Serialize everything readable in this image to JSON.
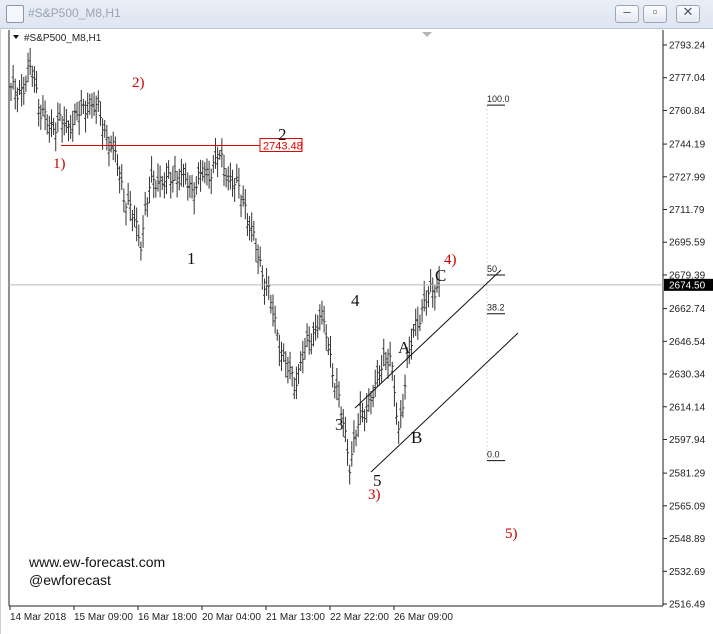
{
  "window": {
    "title": "#S&P500_M8,H1",
    "chart_label": "#S&P500_M8,H1",
    "buttons": [
      "minimize-icon",
      "maximize-icon",
      "close-icon"
    ]
  },
  "watermark": {
    "line1": "www.ew-forecast.com",
    "line2": "@ewforecast"
  },
  "chart_data": {
    "type": "bar",
    "subtype": "ohlc",
    "symbol": "#S&P500_M8",
    "timeframe": "H1",
    "y_ticks": [
      2793.24,
      2777.04,
      2760.84,
      2744.19,
      2727.99,
      2711.79,
      2695.59,
      2679.39,
      2662.74,
      2646.54,
      2630.34,
      2614.14,
      2597.94,
      2581.29,
      2565.09,
      2548.89,
      2532.69,
      2516.49
    ],
    "x_ticks": [
      "14 Mar 2018",
      "15 Mar 09:00",
      "16 Mar 18:00",
      "20 Mar 04:00",
      "21 Mar 13:00",
      "22 Mar 22:00",
      "26 Mar 09:00"
    ],
    "ylim": [
      2514,
      2799
    ],
    "current_price": 2674.5,
    "price_line_label": "2743.48",
    "price_line_value": 2743.48,
    "series_close_path": [
      [
        0,
        2770
      ],
      [
        6,
        2772
      ],
      [
        10,
        2783
      ],
      [
        14,
        2760
      ],
      [
        18,
        2752
      ],
      [
        22,
        2756
      ],
      [
        26,
        2752
      ],
      [
        30,
        2758
      ],
      [
        34,
        2760
      ],
      [
        37,
        2766
      ],
      [
        41,
        2760
      ],
      [
        45,
        2748
      ],
      [
        49,
        2738
      ],
      [
        53,
        2720
      ],
      [
        57,
        2708
      ],
      [
        61,
        2697
      ],
      [
        65,
        2722
      ],
      [
        69,
        2728
      ],
      [
        73,
        2724
      ],
      [
        77,
        2730
      ],
      [
        81,
        2727
      ],
      [
        85,
        2722
      ],
      [
        89,
        2728
      ],
      [
        93,
        2730
      ],
      [
        97,
        2738
      ],
      [
        101,
        2731
      ],
      [
        105,
        2724
      ],
      [
        109,
        2718
      ],
      [
        113,
        2700
      ],
      [
        117,
        2685
      ],
      [
        121,
        2670
      ],
      [
        125,
        2650
      ],
      [
        129,
        2635
      ],
      [
        133,
        2625
      ],
      [
        137,
        2640
      ],
      [
        141,
        2648
      ],
      [
        145,
        2660
      ],
      [
        148,
        2650
      ],
      [
        152,
        2628
      ],
      [
        156,
        2605
      ],
      [
        159,
        2587
      ],
      [
        163,
        2605
      ],
      [
        167,
        2615
      ],
      [
        171,
        2622
      ],
      [
        175,
        2640
      ],
      [
        178,
        2638
      ],
      [
        182,
        2602
      ],
      [
        186,
        2635
      ],
      [
        190,
        2655
      ],
      [
        194,
        2665
      ],
      [
        198,
        2672
      ],
      [
        201,
        2676
      ]
    ],
    "annotations_red": [
      "1)",
      "2)",
      "3)",
      "4)",
      "5)"
    ],
    "annotations_black": [
      "1",
      "2",
      "3",
      "4",
      "5",
      "A",
      "B",
      "C"
    ],
    "fibonacci": {
      "levels": [
        "100.0",
        "50",
        "38.2",
        "0.0"
      ],
      "values": [
        2763.5,
        2679.4,
        2660.2,
        2587.5
      ]
    },
    "channel_lines": true,
    "crosshair_line": true
  }
}
